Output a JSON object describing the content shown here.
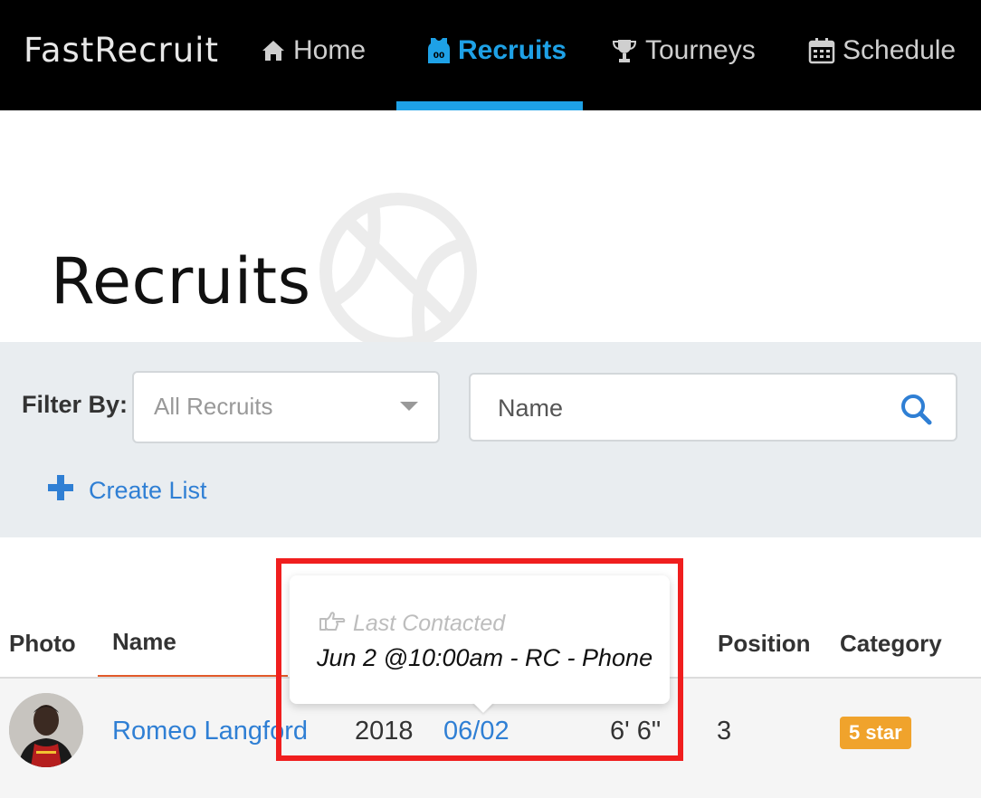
{
  "app": {
    "brand": "FastRecruit"
  },
  "nav": {
    "items": [
      {
        "label": "Home",
        "icon": "home-icon"
      },
      {
        "label": "Recruits",
        "icon": "jersey-icon",
        "active": true
      },
      {
        "label": "Tourneys",
        "icon": "trophy-icon"
      },
      {
        "label": "Schedule",
        "icon": "calendar-icon"
      }
    ]
  },
  "page": {
    "title": "Recruits",
    "decoration_icon": "basketball-icon"
  },
  "filter": {
    "label": "Filter By:",
    "select_value": "All Recruits",
    "search_placeholder": "Name",
    "create_list_label": "Create List"
  },
  "table": {
    "headers": {
      "photo": "Photo",
      "name": "Name",
      "position": "Position",
      "category": "Category"
    },
    "rows": [
      {
        "name": "Romeo Langford",
        "year": "2018",
        "last_contact": "06/02",
        "height": "6' 6\"",
        "position": "3",
        "category": "5 star"
      }
    ]
  },
  "tooltip": {
    "heading": "Last Contacted",
    "text": "Jun 2 @10:00am - RC - Phone",
    "icon": "hand-point-right-icon"
  },
  "colors": {
    "nav_bg": "#000000",
    "accent": "#1ea1e6",
    "link": "#2f7fd4",
    "sort_underline": "#e25a2a",
    "badge": "#f0a32c",
    "highlight": "#f01e1e"
  }
}
